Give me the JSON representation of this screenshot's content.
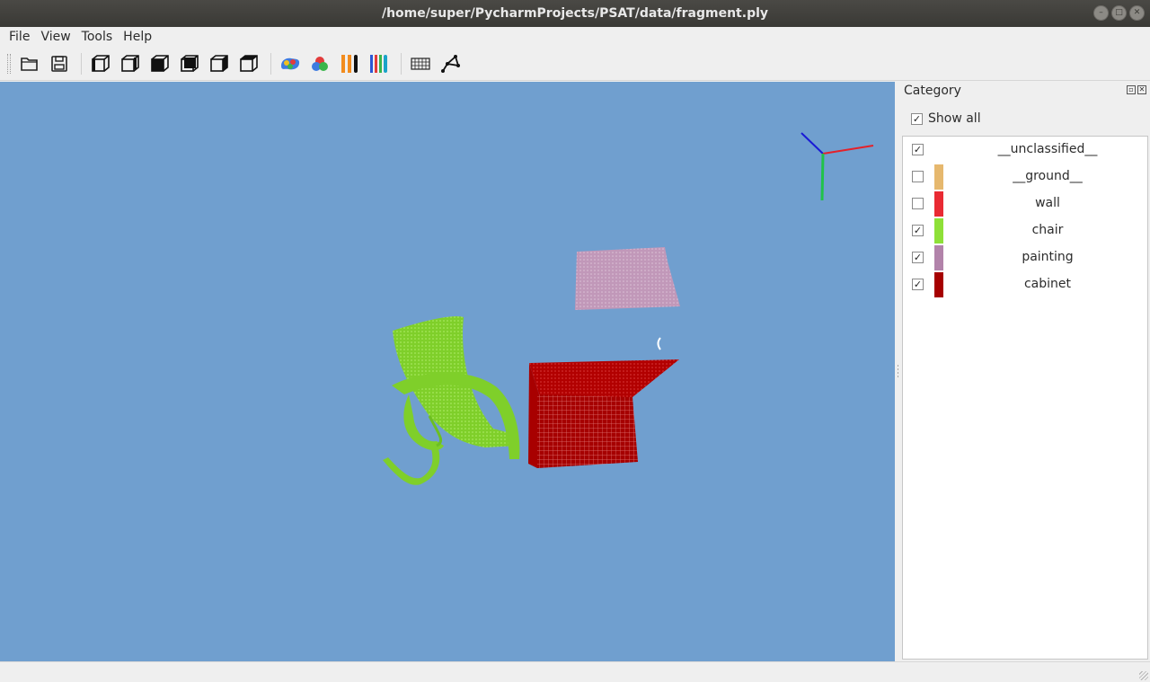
{
  "window": {
    "title": "/home/super/PycharmProjects/PSAT/data/fragment.ply"
  },
  "menu": {
    "file": "File",
    "view": "View",
    "tools": "Tools",
    "help": "Help"
  },
  "toolbar": {
    "icons": [
      "open-folder-icon",
      "save-icon",
      "front-view-icon",
      "back-view-icon",
      "left-view-icon",
      "right-view-icon",
      "top-view-icon",
      "bottom-view-icon",
      "rgb-color-icon",
      "category-color-icon",
      "elevation-color-icon",
      "instance-color-icon",
      "grid-icon",
      "skeleton-icon"
    ]
  },
  "viewport": {
    "background": "#709fcf",
    "objects": [
      {
        "name": "chair",
        "color": "#86d62e"
      },
      {
        "name": "cabinet",
        "color": "#b20000"
      },
      {
        "name": "painting",
        "color": "#c294b5"
      }
    ],
    "axes": {
      "x": "#e4212a",
      "y": "#21c24a",
      "z": "#1a1ad6"
    }
  },
  "category_panel": {
    "title": "Category",
    "show_all_label": "Show all",
    "show_all_checked": true,
    "items": [
      {
        "label": "__unclassified__",
        "checked": true,
        "color": ""
      },
      {
        "label": "__ground__",
        "checked": false,
        "color": "#e6b86e"
      },
      {
        "label": "wall",
        "checked": false,
        "color": "#e92a33"
      },
      {
        "label": "chair",
        "checked": true,
        "color": "#8ee038"
      },
      {
        "label": "painting",
        "checked": true,
        "color": "#b283aa"
      },
      {
        "label": "cabinet",
        "checked": true,
        "color": "#a60000"
      }
    ]
  }
}
